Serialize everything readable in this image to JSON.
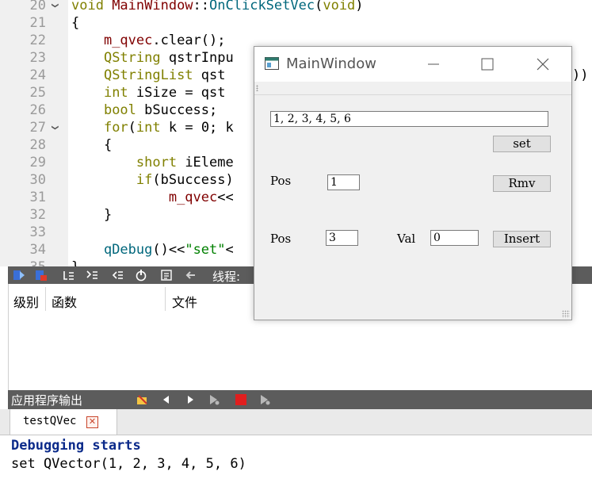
{
  "editor": {
    "lines": [
      {
        "num": "20",
        "fold": true,
        "parts": [
          [
            "kw",
            "void "
          ],
          [
            "id",
            "MainWindow"
          ],
          [
            "op",
            "::"
          ],
          [
            "fn",
            "OnClickSetVec"
          ],
          [
            "op",
            "("
          ],
          [
            "kw",
            "void"
          ],
          [
            "op",
            ")"
          ]
        ]
      },
      {
        "num": "21",
        "fold": false,
        "parts": [
          [
            "pl",
            "{"
          ]
        ]
      },
      {
        "num": "22",
        "fold": false,
        "parts": [
          [
            "pl",
            "    "
          ],
          [
            "id",
            "m_qvec"
          ],
          [
            "op",
            "."
          ],
          [
            "pl",
            "clear();"
          ]
        ]
      },
      {
        "num": "23",
        "fold": false,
        "parts": [
          [
            "pl",
            "    "
          ],
          [
            "ty",
            "QString"
          ],
          [
            "pl",
            " qstrInpu"
          ]
        ]
      },
      {
        "num": "24",
        "fold": false,
        "parts": [
          [
            "pl",
            "    "
          ],
          [
            "ty",
            "QStringList"
          ],
          [
            "pl",
            " qst"
          ]
        ]
      },
      {
        "num": "25",
        "fold": false,
        "parts": [
          [
            "pl",
            "    "
          ],
          [
            "kw",
            "int"
          ],
          [
            "pl",
            " iSize = qst"
          ]
        ]
      },
      {
        "num": "26",
        "fold": false,
        "parts": [
          [
            "pl",
            "    "
          ],
          [
            "kw",
            "bool"
          ],
          [
            "pl",
            " bSuccess;"
          ]
        ]
      },
      {
        "num": "27",
        "fold": true,
        "parts": [
          [
            "pl",
            "    "
          ],
          [
            "kw",
            "for"
          ],
          [
            "op",
            "("
          ],
          [
            "kw",
            "int"
          ],
          [
            "pl",
            " k = 0; k"
          ]
        ]
      },
      {
        "num": "28",
        "fold": false,
        "parts": [
          [
            "pl",
            "    {"
          ]
        ]
      },
      {
        "num": "29",
        "fold": false,
        "parts": [
          [
            "pl",
            "        "
          ],
          [
            "kw",
            "short"
          ],
          [
            "pl",
            " iEleme"
          ]
        ]
      },
      {
        "num": "30",
        "fold": false,
        "parts": [
          [
            "pl",
            "        "
          ],
          [
            "kw",
            "if"
          ],
          [
            "pl",
            "(bSuccess)"
          ]
        ]
      },
      {
        "num": "31",
        "fold": false,
        "parts": [
          [
            "pl",
            "            "
          ],
          [
            "id",
            "m_qvec"
          ],
          [
            "pl",
            "<<"
          ]
        ]
      },
      {
        "num": "32",
        "fold": false,
        "parts": [
          [
            "pl",
            "    }"
          ]
        ]
      },
      {
        "num": "33",
        "fold": false,
        "parts": [
          [
            "pl",
            ""
          ]
        ]
      },
      {
        "num": "34",
        "fold": false,
        "parts": [
          [
            "pl",
            "    "
          ],
          [
            "fn",
            "qDebug"
          ],
          [
            "pl",
            "()<<"
          ],
          [
            "st",
            "\"set\""
          ],
          [
            "pl",
            "<"
          ]
        ]
      },
      {
        "num": "35",
        "fold": false,
        "parts": [
          [
            "pl",
            "}"
          ]
        ]
      }
    ],
    "overflow_right": "))"
  },
  "debugger": {
    "thread_label": "线程:",
    "columns": [
      "级别",
      "函数",
      "文件"
    ]
  },
  "output": {
    "title": "应用程序输出",
    "tab_label": "testQVec",
    "lines": [
      "Debugging starts",
      "set QVector(1, 2, 3, 4, 5, 6)"
    ]
  },
  "main_window": {
    "title": "MainWindow",
    "vector_input": "1, 2, 3, 4, 5, 6",
    "set_label": "set",
    "pos_label": "Pos",
    "remove_pos": "1",
    "remove_label": "Rmv",
    "insert_pos": "3",
    "val_label": "Val",
    "insert_val": "0",
    "insert_label": "Insert"
  }
}
